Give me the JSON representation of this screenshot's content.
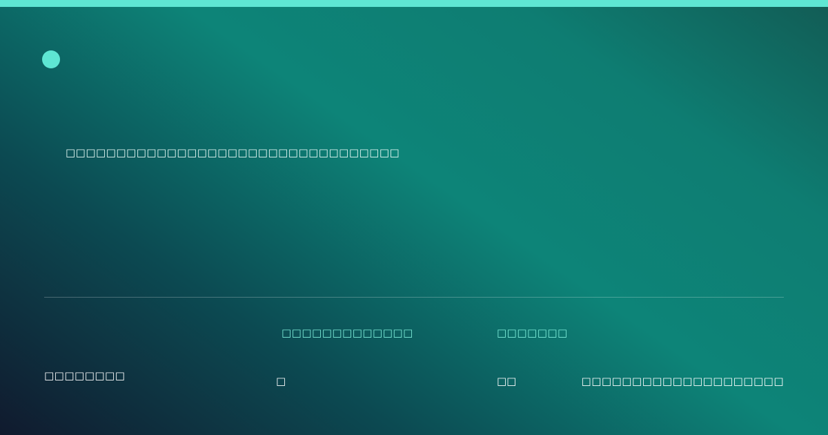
{
  "colors": {
    "accent": "#5ee6d3",
    "label": "#7ff0dc",
    "gradient_dark": "#101a2e",
    "gradient_mid": "#0d8478",
    "gradient_end": "#125c55"
  },
  "headline": "□□□□□□□□□□□□□□□□□□□□□□□□□□□□□□□□□",
  "footer": {
    "brand": "□□□□□□□□",
    "stats": [
      {
        "label": "□□□□□□□□□□□□□",
        "value": "□"
      },
      {
        "label": "□□□□□□□",
        "value": "□□"
      }
    ],
    "url": "□□□□□□□□□□□□□□□□□□□□"
  }
}
